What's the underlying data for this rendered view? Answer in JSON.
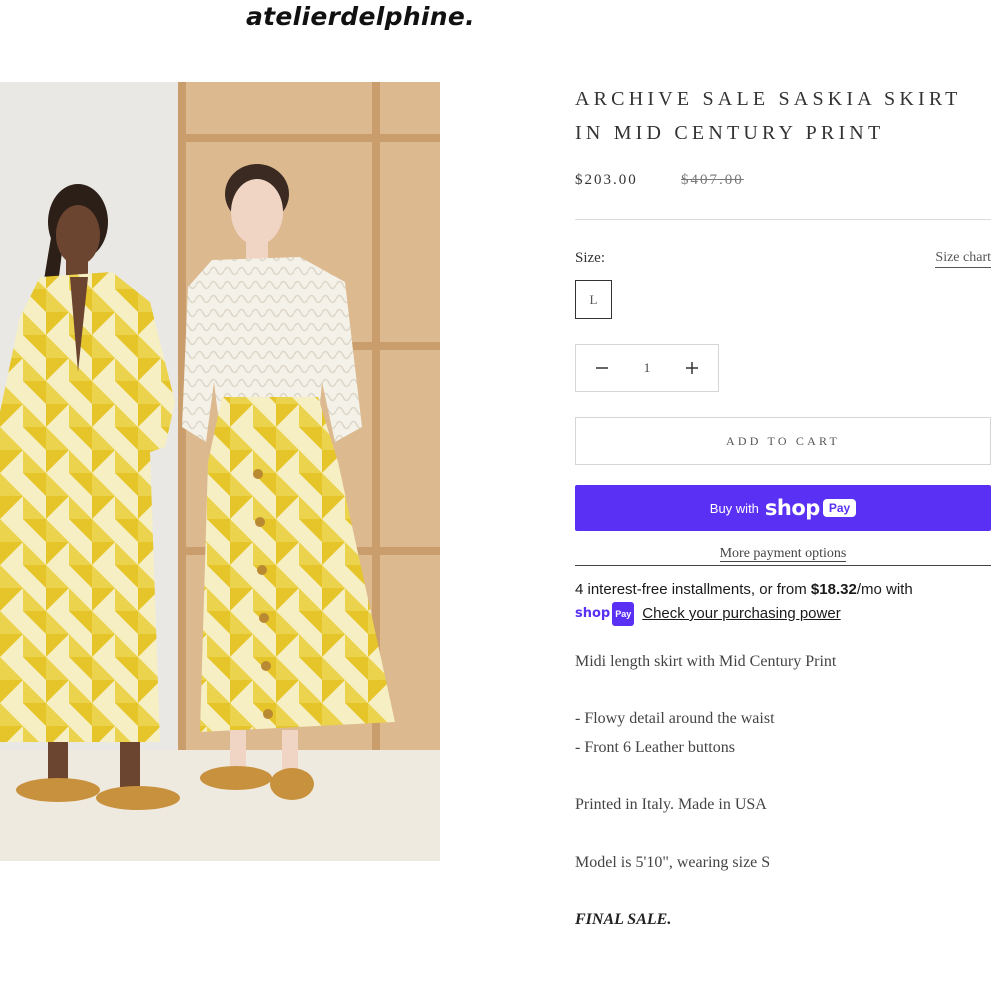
{
  "brand": {
    "logo_text": "atelierdelphine."
  },
  "product": {
    "title": "ARCHIVE SALE SASKIA SKIRT IN MID CENTURY PRINT",
    "price": "$203.00",
    "compare_price": "$407.00",
    "size_label": "Size:",
    "size_chart_label": "Size chart",
    "selected_size": "L",
    "quantity": "1",
    "add_to_cart_label": "ADD TO CART",
    "buy_with_label": "Buy with",
    "shop_pay_brand": "shop",
    "shop_pay_badge": "Pay",
    "more_payment_label": "More payment options",
    "installments_prefix": "4 interest-free installments, or from ",
    "installments_amount": "$18.32",
    "installments_suffix": "/mo with",
    "check_power_label": "Check your purchasing power",
    "description": {
      "line1": "Midi length skirt with Mid Century Print",
      "line2": "- Flowy detail around the waist",
      "line3": "- Front 6 Leather buttons",
      "line4": "Printed in Italy. Made in USA",
      "line5": "Model is 5'10\",  wearing size S",
      "line6": "FINAL SALE."
    }
  },
  "colors": {
    "accent": "#5a31f4",
    "print_yellow": "#e7c926"
  },
  "icons": {
    "minus": "minus-icon",
    "plus": "plus-icon"
  }
}
